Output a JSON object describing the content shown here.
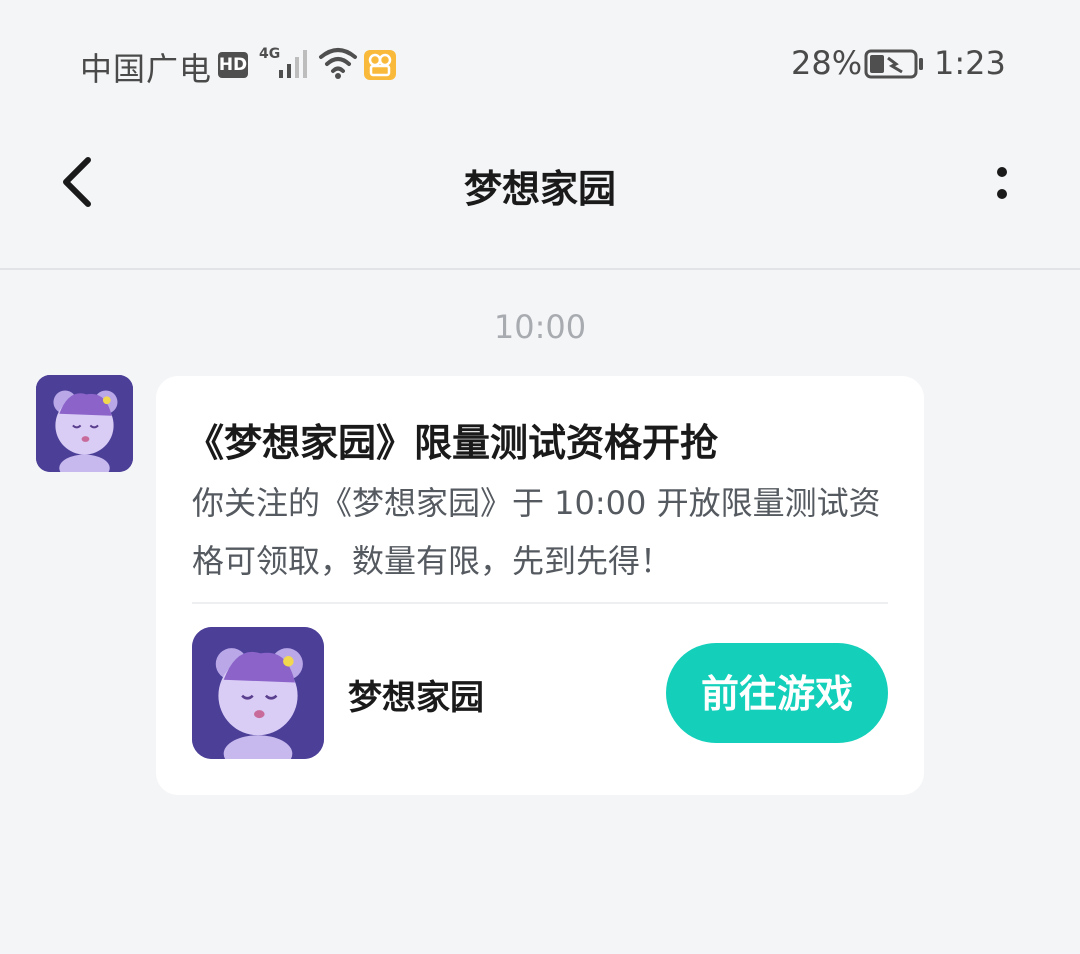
{
  "status_bar": {
    "carrier": "中国广电",
    "hd_label": "HD",
    "network_type": "4G",
    "battery_percent": "28%",
    "time": "1:23",
    "icons": [
      "hd-icon",
      "signal-icon",
      "wifi-icon",
      "app-badge-icon",
      "battery-icon"
    ]
  },
  "header": {
    "title": "梦想家园",
    "back_icon": "chevron-left-icon",
    "more_icon": "more-vertical-icon"
  },
  "chat": {
    "timestamp": "10:00",
    "sender_avatar_icon": "game-avatar-icon",
    "card": {
      "title": "《梦想家园》限量测试资格开抢",
      "description": "你关注的《梦想家园》于 10:00 开放限量测试资格可领取，数量有限，先到先得！",
      "game_name": "梦想家园",
      "game_icon": "game-avatar-icon",
      "action_label": "前往游戏"
    }
  },
  "colors": {
    "background": "#f4f5f7",
    "accent": "#14d0bb",
    "avatar_bg": "#4b3f98",
    "status_badge": "#f9b93a"
  }
}
